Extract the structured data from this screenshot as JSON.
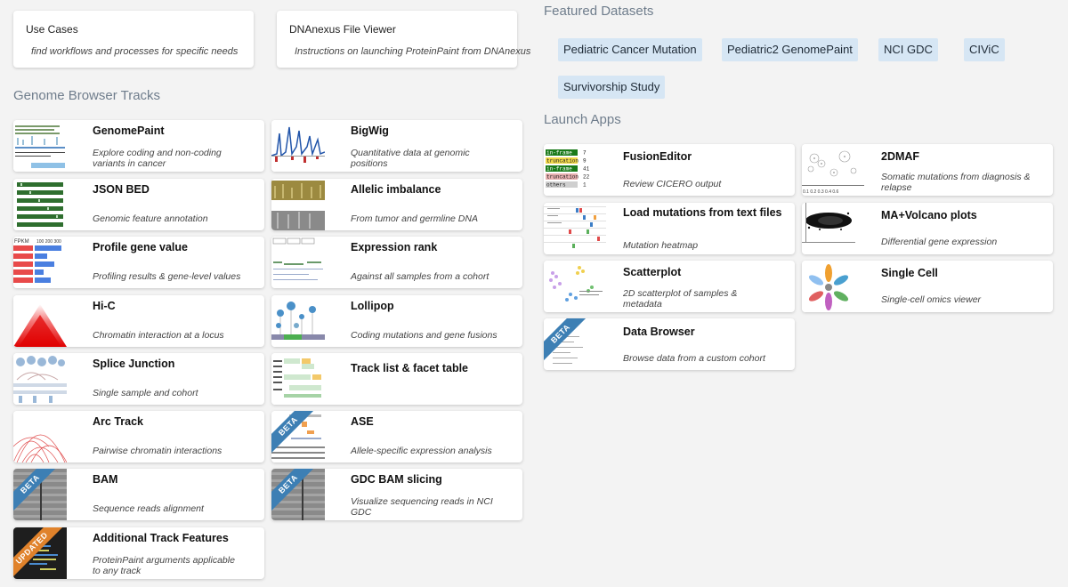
{
  "top_cards": [
    {
      "title": "Use Cases",
      "desc": "find workflows and processes for specific needs"
    },
    {
      "title": "DNAnexus File Viewer",
      "desc": "Instructions on launching ProteinPaint from DNAnexus"
    }
  ],
  "genome_browser": {
    "heading": "Genome Browser Tracks",
    "cards": [
      {
        "title": "GenomePaint",
        "desc": "Explore coding and non-coding variants in cancer"
      },
      {
        "title": "BigWig",
        "desc": "Quantitative data at genomic positions"
      },
      {
        "title": "JSON BED",
        "desc": "Genomic feature annotation"
      },
      {
        "title": "Allelic imbalance",
        "desc": "From tumor and germline DNA"
      },
      {
        "title": "Profile gene value",
        "desc": "Profiling results & gene-level values"
      },
      {
        "title": "Expression rank",
        "desc": "Against all samples from a cohort"
      },
      {
        "title": "Hi-C",
        "desc": "Chromatin interaction at a locus"
      },
      {
        "title": "Lollipop",
        "desc": "Coding mutations and gene fusions"
      },
      {
        "title": "Splice Junction",
        "desc": "Single sample and cohort"
      },
      {
        "title": "Track list & facet table",
        "desc": ""
      },
      {
        "title": "Arc Track",
        "desc": "Pairwise chromatin interactions"
      },
      {
        "title": "ASE",
        "desc": "Allele-specific expression analysis",
        "ribbon": "BETA"
      },
      {
        "title": "BAM",
        "desc": "Sequence reads alignment",
        "ribbon": "BETA"
      },
      {
        "title": "GDC BAM slicing",
        "desc": "Visualize sequencing reads in NCI GDC",
        "ribbon": "BETA"
      },
      {
        "title": "Additional Track Features",
        "desc": "ProteinPaint arguments applicable to any track",
        "ribbon": "UPDATED"
      }
    ]
  },
  "featured": {
    "heading": "Featured Datasets",
    "pills": [
      "Pediatric Cancer Mutation",
      "Pediatric2 GenomePaint",
      "NCI GDC",
      "CIViC",
      "Survivorship Study"
    ]
  },
  "launch_apps": {
    "heading": "Launch Apps",
    "cards": [
      {
        "title": "FusionEditor",
        "desc": "Review CICERO output"
      },
      {
        "title": "2DMAF",
        "desc": "Somatic mutations from diagnosis & relapse"
      },
      {
        "title": "Load mutations from text files",
        "desc": "Mutation heatmap"
      },
      {
        "title": "MA+Volcano plots",
        "desc": "Differential gene expression"
      },
      {
        "title": "Scatterplot",
        "desc": "2D scatterplot of samples & metadata"
      },
      {
        "title": "Single Cell",
        "desc": "Single-cell omics viewer"
      },
      {
        "title": "Data Browser",
        "desc": "Browse data from a custom cohort",
        "ribbon": "BETA"
      }
    ]
  },
  "thumb_text": {
    "fpkm": "FPKM",
    "fpkm_ticks": "100 200 300",
    "fusion_rows": [
      {
        "label": "in-frame",
        "count": "7",
        "color": "#1a7a1a"
      },
      {
        "label": "truncation",
        "count": "9",
        "color": "#f0d84a"
      },
      {
        "label": "in-frame",
        "count": "41",
        "color": "#1a7a1a"
      },
      {
        "label": "truncation",
        "count": "22",
        "color": "#e8b0b0"
      },
      {
        "label": "others",
        "count": "1",
        "color": "#cfcfcf"
      }
    ],
    "maf_ticks": "0.1 0.2 0.3 0.4 0.6"
  }
}
